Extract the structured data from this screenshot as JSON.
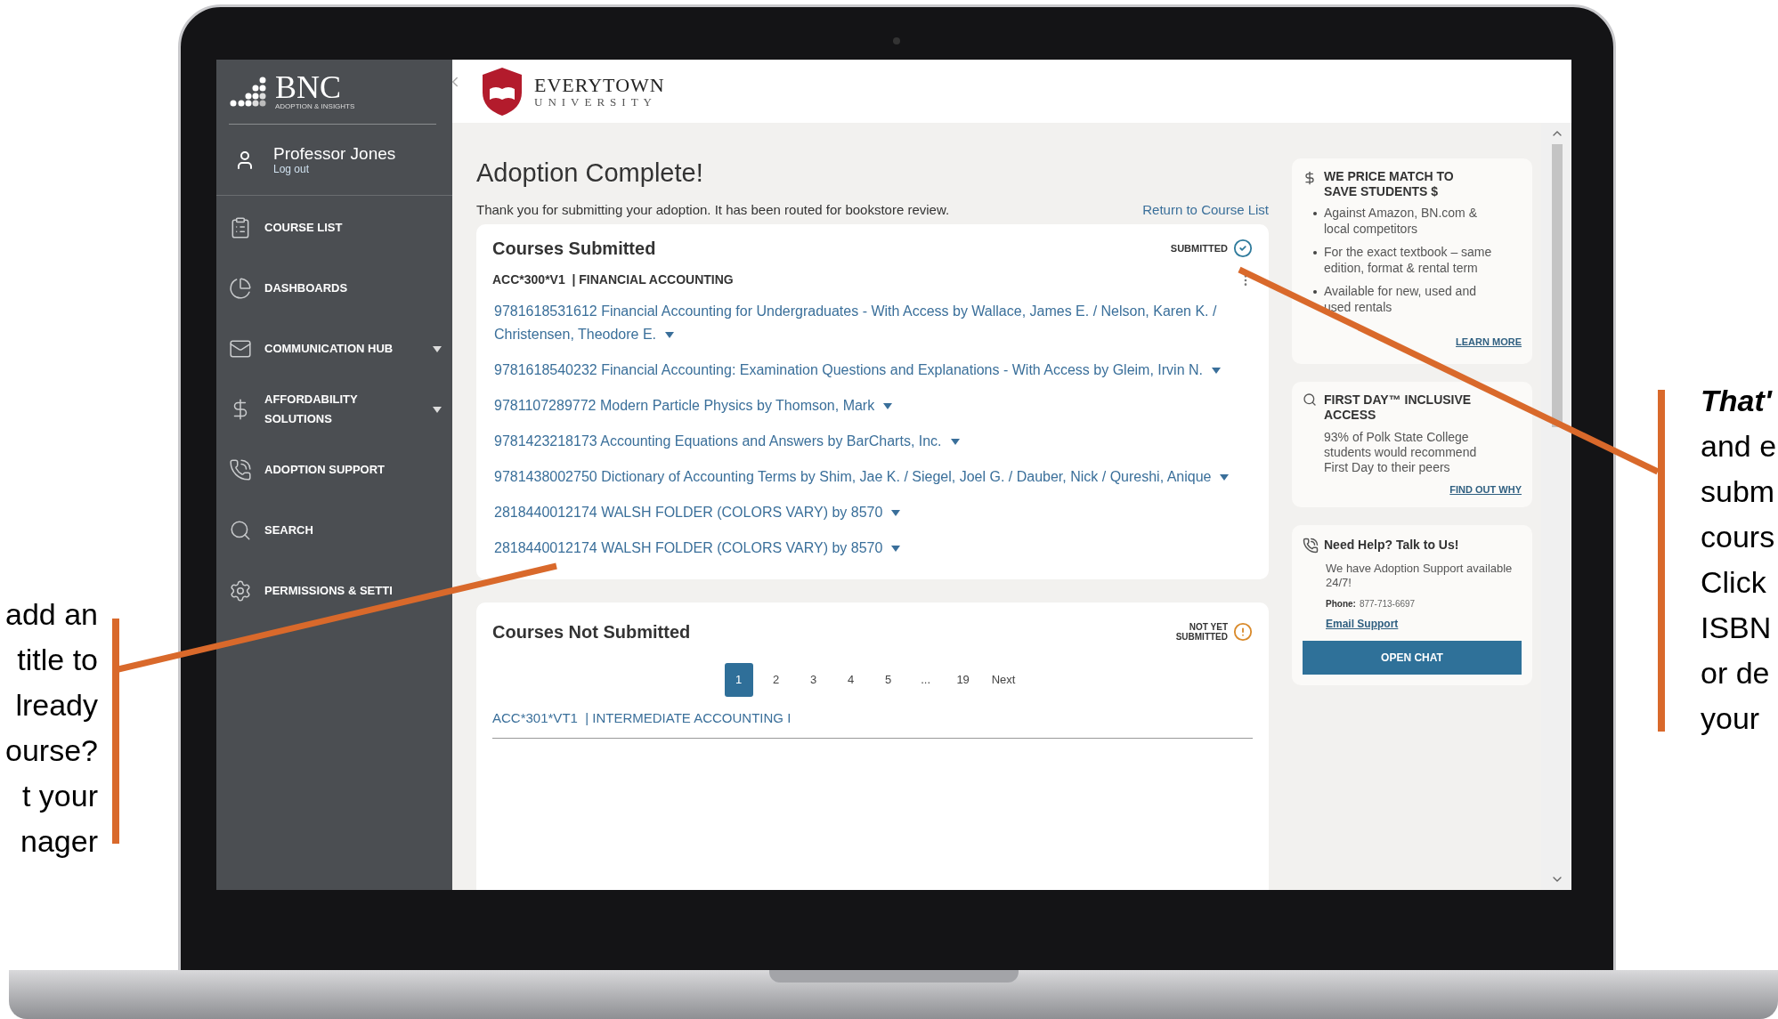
{
  "left_note": {
    "lines": [
      {
        "text": "add an",
        "emphasis": false
      },
      {
        "text": "title to",
        "emphasis": false
      },
      {
        "text": "lready",
        "emphasis": false
      },
      {
        "text": "ourse?",
        "emphasis": false
      },
      {
        "text": "t your",
        "emphasis": false
      },
      {
        "text": "nager",
        "emphasis": false
      }
    ]
  },
  "right_note": {
    "lines": [
      {
        "text": "That'",
        "emphasis": true
      },
      {
        "text": "and e",
        "emphasis": false
      },
      {
        "text": "subm",
        "emphasis": false
      },
      {
        "text": "cours",
        "emphasis": false
      },
      {
        "text": "Click",
        "emphasis": false
      },
      {
        "text": "ISBN",
        "emphasis": false
      },
      {
        "text": "or de",
        "emphasis": false
      },
      {
        "text": "your",
        "emphasis": false
      }
    ]
  },
  "sidebar": {
    "brand": "BNC",
    "tagline": "ADOPTION & INSIGHTS",
    "user": {
      "name": "Professor Jones",
      "logout": "Log out"
    },
    "items": [
      {
        "label": "COURSE LIST",
        "expandable": false
      },
      {
        "label": "DASHBOARDS",
        "expandable": false
      },
      {
        "label": "COMMUNICATION HUB",
        "expandable": true
      },
      {
        "label": "AFFORDABILITY SOLUTIONS",
        "expandable": true
      },
      {
        "label": "ADOPTION SUPPORT",
        "expandable": false
      },
      {
        "label": "SEARCH",
        "expandable": false
      },
      {
        "label": "PERMISSIONS & SETTI",
        "expandable": false
      }
    ]
  },
  "topbar": {
    "school": "EVERYTOWN",
    "school_sub": "UNIVERSITY"
  },
  "main": {
    "title": "Adoption Complete!",
    "message": "Thank you for submitting your adoption. It has been routed for bookstore review.",
    "return_link": "Return to Course List",
    "submitted": {
      "title": "Courses Submitted",
      "status": "SUBMITTED",
      "course": "ACC*300*V1  | FINANCIAL ACCOUNTING",
      "books": [
        "9781618531612 Financial Accounting for Undergraduates - With Access by Wallace, James E. / Nelson, Karen K. / Christensen, Theodore E.",
        "9781618540232 Financial Accounting: Examination Questions and Explanations - With Access by Gleim, Irvin N.",
        "9781107289772 Modern Particle Physics by Thomson, Mark",
        "9781423218173 Accounting Equations and Answers by BarCharts, Inc.",
        "9781438002750 Dictionary of Accounting Terms by Shim, Jae K. / Siegel, Joel G. / Dauber, Nick / Qureshi, Anique",
        "2818440012174 WALSH FOLDER (COLORS VARY) by 8570",
        "2818440012174 WALSH FOLDER (COLORS VARY) by 8570"
      ]
    },
    "not_submitted": {
      "title": "Courses Not Submitted",
      "status_lines": [
        "NOT YET",
        "SUBMITTED"
      ],
      "pages": [
        {
          "label": "1",
          "selected": true
        },
        {
          "label": "2",
          "selected": false
        },
        {
          "label": "3",
          "selected": false
        },
        {
          "label": "4",
          "selected": false
        },
        {
          "label": "5",
          "selected": false
        },
        {
          "label": "...",
          "selected": false
        },
        {
          "label": "19",
          "selected": false
        },
        {
          "label": "Next",
          "selected": false
        }
      ],
      "course": "ACC*301*VT1  | INTERMEDIATE ACCOUNTING I"
    }
  },
  "side_panel": {
    "price_match": {
      "title": "WE PRICE MATCH TO SAVE STUDENTS $",
      "bullets": [
        "Against Amazon, BN.com & local competitors",
        "For the exact textbook – same edition, format & rental term",
        "Available for new, used and used rentals"
      ],
      "link": "LEARN MORE"
    },
    "first_day": {
      "title": "FIRST DAY™ INCLUSIVE ACCESS",
      "body": "93% of Polk State College students would recommend First Day to their peers",
      "link": "FIND OUT WHY"
    },
    "help": {
      "title": "Need Help? Talk to Us!",
      "body": "We have Adoption Support available 24/7!",
      "phone_label": "Phone:",
      "phone": "877-713-6697",
      "email_link": "Email Support",
      "button": "OPEN CHAT"
    }
  }
}
